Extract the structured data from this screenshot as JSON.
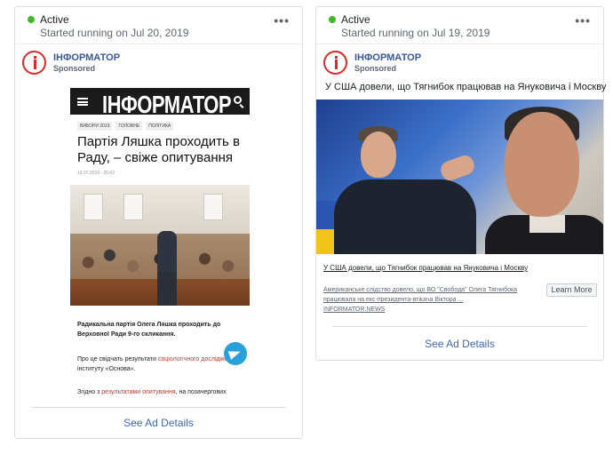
{
  "cards": [
    {
      "status": "Active",
      "started": "Started running on Jul 20, 2019",
      "more_label": "•••",
      "advertiser": "ІНФОРМАТОР",
      "sponsored": "Sponsored",
      "article": {
        "brand": "ІНФОРМАТОР",
        "tags": [
          "ВИБОРИ 2019",
          "ГОЛОВНЕ",
          "ПОЛІТИКА"
        ],
        "title": "Партія Ляшка проходить в Раду, – свіже опитування",
        "date": "19.07.2019 - 20:02",
        "p1": "Радикальна партія Олега Ляшка проходить до Верховної Ради 9-го скликання.",
        "p2_a": "Про це свідчать результати ",
        "p2_link": "соціологічного дослідження",
        "p2_b": " інституту «Основа».",
        "p3_a": "Згідно з ",
        "p3_link": "результатами опитування",
        "p3_b": ", на позачергових"
      },
      "details": "See Ad Details"
    },
    {
      "status": "Active",
      "started": "Started running on Jul 19, 2019",
      "more_label": "•••",
      "advertiser": "ІНФОРМАТОР",
      "sponsored": "Sponsored",
      "ad_text": "У США довели, що Тягнибок працював на Януковича і Москву",
      "link_title": "У США довели, що Тягнибок працював на Януковича і Москву",
      "link_desc": "Американське слідство довело, що ВО \"Свобода\" Олега Тягнибока працювала на екс-президента-втікача Віктора ...",
      "domain": "INFORMATOR.NEWS",
      "cta": "Learn More",
      "details": "See Ad Details"
    }
  ],
  "colors": {
    "active_dot": "#42b72a",
    "link": "#4267b2",
    "brand_red": "#d72b2b"
  }
}
